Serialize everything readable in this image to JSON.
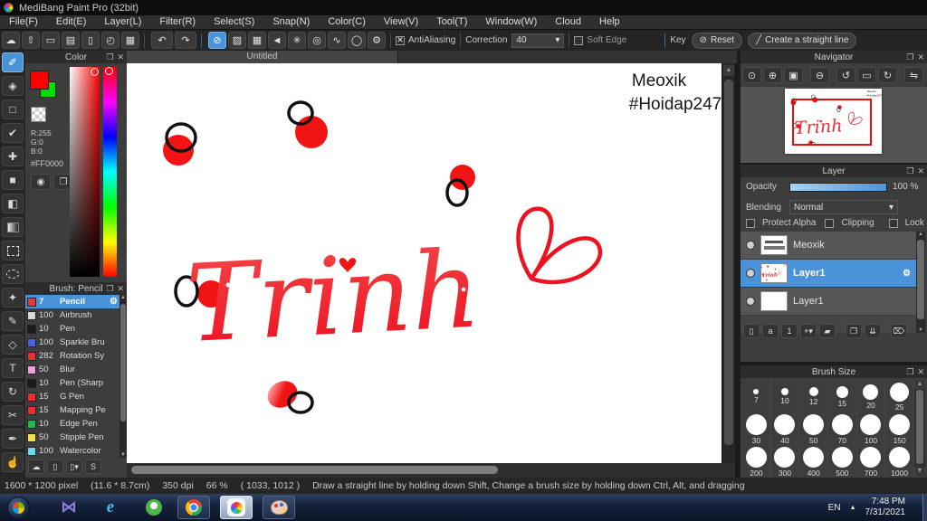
{
  "window": {
    "title": "MediBang Paint Pro (32bit)"
  },
  "menu": [
    "File(F)",
    "Edit(E)",
    "Layer(L)",
    "Filter(R)",
    "Select(S)",
    "Snap(N)",
    "Color(C)",
    "View(V)",
    "Tool(T)",
    "Window(W)",
    "Cloud",
    "Help"
  ],
  "toolbar": {
    "quick_icons": [
      {
        "name": "cloud-icon",
        "glyph": "☁"
      },
      {
        "name": "publish-icon",
        "glyph": "⇧"
      },
      {
        "name": "comment-icon",
        "glyph": "▭"
      },
      {
        "name": "comments-icon",
        "glyph": "▤"
      },
      {
        "name": "document-icon",
        "glyph": "▯"
      },
      {
        "name": "history-icon",
        "glyph": "◴"
      },
      {
        "name": "tiles-icon",
        "glyph": "▦"
      }
    ],
    "undo_icon": "↶",
    "redo_icon": "↷",
    "snap_icons": [
      {
        "name": "snap-off-icon",
        "glyph": "⊘",
        "active": true
      },
      {
        "name": "parallel-snap-icon",
        "glyph": "▨"
      },
      {
        "name": "grid-snap-icon",
        "glyph": "▦"
      },
      {
        "name": "vanishing-point-snap-icon",
        "glyph": "◄"
      },
      {
        "name": "radial-snap-icon",
        "glyph": "✳"
      },
      {
        "name": "concentric-snap-icon",
        "glyph": "◎"
      },
      {
        "name": "curve-snap-icon",
        "glyph": "∿"
      },
      {
        "name": "ellipse-snap-icon",
        "glyph": "◯"
      },
      {
        "name": "snap-settings-icon",
        "glyph": "⚙"
      }
    ],
    "antialiasing_label": "AntiAliasing",
    "correction_label": "Correction",
    "correction_value": "40",
    "soft_edge_label": "Soft Edge",
    "key_label": "Key",
    "reset_label": "Reset",
    "create_line_label": "Create a straight line"
  },
  "tools": [
    {
      "name": "brush",
      "glyph": "✐",
      "selected": true
    },
    {
      "name": "eraser",
      "glyph": "◈"
    },
    {
      "name": "figure-brush",
      "glyph": "□"
    },
    {
      "name": "control-point",
      "glyph": "✔"
    },
    {
      "name": "move",
      "glyph": "✚"
    },
    {
      "name": "fill-shape",
      "glyph": "■"
    },
    {
      "name": "bucket",
      "glyph": "◧"
    },
    {
      "name": "gradient",
      "css": "grad"
    },
    {
      "name": "select-rectangle",
      "css": "marquee"
    },
    {
      "name": "select-lasso",
      "css": "lasso"
    },
    {
      "name": "magic-wand",
      "glyph": "✦"
    },
    {
      "name": "select-pen",
      "glyph": "✎"
    },
    {
      "name": "select-eraser",
      "glyph": "◇"
    },
    {
      "name": "text",
      "glyph": "T"
    },
    {
      "name": "transform",
      "glyph": "↻"
    },
    {
      "name": "divide",
      "glyph": "✂"
    },
    {
      "name": "eyedropper",
      "glyph": "✒"
    },
    {
      "name": "hand",
      "glyph": "☝"
    }
  ],
  "color_panel": {
    "title": "Color",
    "r_label": "R:255",
    "g_label": "G:0",
    "b_label": "B:0",
    "hex": "#FF0000",
    "foreground_color": "#FF0000",
    "background_color": "#00DD00",
    "buttons": [
      {
        "name": "palette-icon",
        "glyph": "◉"
      },
      {
        "name": "color-set-icon",
        "glyph": "❐"
      }
    ]
  },
  "brush_panel": {
    "title": "Brush: Pencil",
    "brushes": [
      {
        "size": "7",
        "name": "Pencil",
        "color": "#e03a3a",
        "selected": true
      },
      {
        "size": "100",
        "name": "Airbrush",
        "color": "#d8d8d8"
      },
      {
        "size": "10",
        "name": "Pen",
        "color": "#1a1a1a"
      },
      {
        "size": "100",
        "name": "Sparkle Bru",
        "color": "#4a62e8"
      },
      {
        "size": "282",
        "name": "Rotation Sy",
        "color": "#e83030"
      },
      {
        "size": "50",
        "name": "Blur",
        "color": "#f0a0e0"
      },
      {
        "size": "10",
        "name": "Pen (Sharp",
        "color": "#1a1a1a"
      },
      {
        "size": "15",
        "name": "G Pen",
        "color": "#e83030"
      },
      {
        "size": "15",
        "name": "Mapping Pe",
        "color": "#e83030"
      },
      {
        "size": "10",
        "name": "Edge Pen",
        "color": "#28b44c"
      },
      {
        "size": "50",
        "name": "Stipple Pen",
        "color": "#f0e040"
      },
      {
        "size": "100",
        "name": "Watercolor",
        "color": "#70d8ee"
      }
    ],
    "tool_icons": [
      {
        "name": "upload-brush-icon",
        "glyph": "☁"
      },
      {
        "name": "add-brush-icon",
        "glyph": "▯"
      },
      {
        "name": "add-brush-menu-icon",
        "glyph": "▯▾"
      },
      {
        "name": "script-brush-icon",
        "glyph": "S"
      }
    ]
  },
  "canvas": {
    "tab": "Untitled",
    "watermark_line1": "Meoxik",
    "watermark_line2": "#Hoidap247",
    "artwork_text": "Trinh",
    "ink_color": "#ee1220"
  },
  "navigator": {
    "title": "Navigator",
    "icons": [
      {
        "name": "zoom-original-icon",
        "glyph": "⊙"
      },
      {
        "name": "zoom-in-icon",
        "glyph": "⊕"
      },
      {
        "name": "fit-window-icon",
        "glyph": "▣"
      },
      {
        "name": "zoom-out-icon",
        "glyph": "⊖",
        "gap": true
      },
      {
        "name": "rotate-left-icon",
        "glyph": "↺",
        "gap": true
      },
      {
        "name": "reset-view-icon",
        "glyph": "▭"
      },
      {
        "name": "rotate-right-icon",
        "glyph": "↻"
      },
      {
        "name": "flip-horizontal-icon",
        "glyph": "⇋",
        "gap": true
      }
    ]
  },
  "layer_panel": {
    "title": "Layer",
    "opacity_label": "Opacity",
    "opacity_value": "100 %",
    "blending_label": "Blending",
    "blending_value": "Normal",
    "protect_alpha_label": "Protect Alpha",
    "clipping_label": "Clipping",
    "lock_label": "Lock",
    "layers": [
      {
        "name": "Meoxik",
        "thumb": "text"
      },
      {
        "name": "Layer1",
        "thumb": "art",
        "selected": true
      },
      {
        "name": "Layer1",
        "thumb": "empty"
      }
    ],
    "tool_icons": [
      {
        "name": "add-layer-icon",
        "glyph": "▯"
      },
      {
        "name": "add-8bit-layer-icon",
        "glyph": "a"
      },
      {
        "name": "add-1bit-layer-icon",
        "glyph": "1"
      },
      {
        "name": "add-layer-menu-icon",
        "glyph": "+▾"
      },
      {
        "name": "layer-folder-icon",
        "glyph": "▰"
      },
      {
        "name": "duplicate-layer-icon",
        "glyph": "❐",
        "gap": true
      },
      {
        "name": "merge-layer-icon",
        "glyph": "⇊"
      },
      {
        "name": "delete-layer-icon",
        "glyph": "⌦",
        "gap": true
      }
    ]
  },
  "brush_size_panel": {
    "title": "Brush Size",
    "sizes": [
      7,
      10,
      12,
      15,
      20,
      25,
      30,
      40,
      50,
      70,
      100,
      150,
      200,
      300,
      400,
      500,
      700,
      1000
    ]
  },
  "status_bar": {
    "size": "1600 * 1200 pixel",
    "dimensions": "(11.6 * 8.7cm)",
    "dpi": "350 dpi",
    "zoom": "66 %",
    "coords": "( 1033, 1012 )",
    "hint": "Draw a straight line by holding down Shift, Change a brush size by holding down Ctrl, Alt, and dragging"
  },
  "taskbar": {
    "apps": [
      "start",
      "kmplayer",
      "internet-explorer",
      "coccoc",
      "chrome",
      "medibang-paint",
      "ms-paint"
    ],
    "language": "EN",
    "time": "7:48 PM",
    "date": "7/31/2021"
  }
}
